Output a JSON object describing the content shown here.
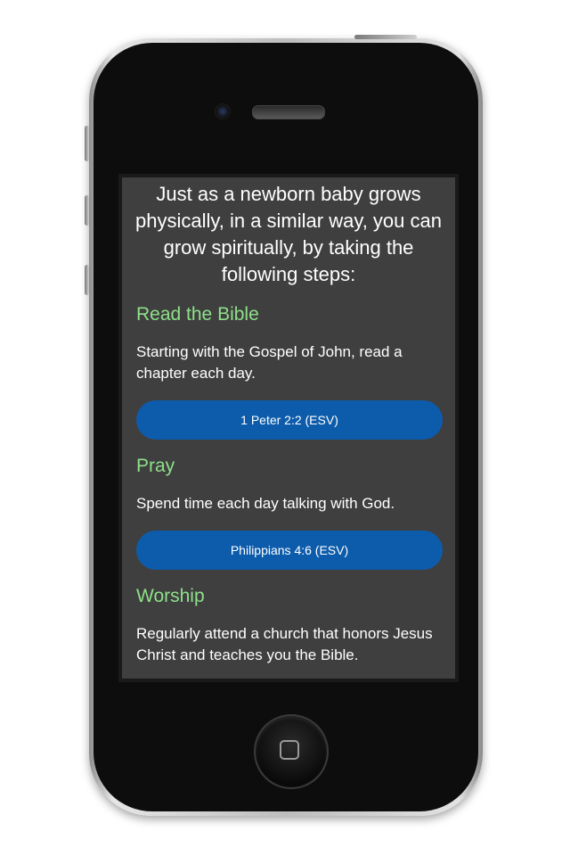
{
  "intro_text": "Just as a newborn baby grows physically, in a similar way, you can grow spiritually, by taking the following steps:",
  "sections": [
    {
      "title": "Read the Bible",
      "body": "Starting with the Gospel of John, read a chapter each day.",
      "verse_button": "1 Peter 2:2 (ESV)"
    },
    {
      "title": "Pray",
      "body": "Spend time each day talking with God.",
      "verse_button": "Philippians 4:6 (ESV)"
    },
    {
      "title": "Worship",
      "body": "Regularly attend a church that honors Jesus Christ and teaches you the Bible."
    }
  ],
  "colors": {
    "screen_bg": "#3f3f3f",
    "section_title": "#8ee08a",
    "button_bg": "#0d5cab",
    "text": "#ffffff"
  },
  "icons": {
    "home_button": "home-square-icon",
    "camera": "front-camera-icon",
    "speaker": "earpiece-speaker-icon"
  }
}
